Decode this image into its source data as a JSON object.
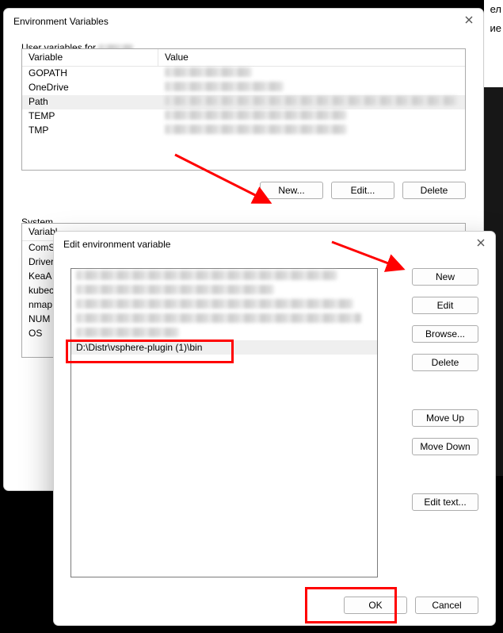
{
  "bg_fragments": {
    "f1": "ел",
    "f2": "ие"
  },
  "win1": {
    "title": "Environment Variables",
    "groups": {
      "user": {
        "label_prefix": "User variables for ",
        "columns": {
          "c1": "Variable",
          "c2": "Value"
        },
        "rows": [
          {
            "name": "GOPATH"
          },
          {
            "name": "OneDrive"
          },
          {
            "name": "Path",
            "selected": true
          },
          {
            "name": "TEMP"
          },
          {
            "name": "TMP"
          }
        ],
        "buttons": {
          "new": "New...",
          "edit": "Edit...",
          "delete": "Delete"
        }
      },
      "system": {
        "label": "System",
        "columns": {
          "c1": "Variabl",
          "c2": ""
        },
        "rows": [
          {
            "name": "ComS"
          },
          {
            "name": "Driver"
          },
          {
            "name": "KeaA"
          },
          {
            "name": "kubec"
          },
          {
            "name": "nmap"
          },
          {
            "name": "NUM"
          },
          {
            "name": "OS"
          }
        ]
      }
    }
  },
  "win2": {
    "title": "Edit environment variable",
    "entries": [
      {
        "visible": false
      },
      {
        "visible": false
      },
      {
        "visible": false
      },
      {
        "visible": false
      },
      {
        "visible": false
      },
      {
        "visible": true,
        "value": "D:\\Distr\\vsphere-plugin (1)\\bin",
        "selected": true
      }
    ],
    "side_buttons": {
      "new": "New",
      "edit": "Edit",
      "browse": "Browse...",
      "delete": "Delete",
      "moveup": "Move Up",
      "movedown": "Move Down",
      "edittext": "Edit text..."
    },
    "footer": {
      "ok": "OK",
      "cancel": "Cancel"
    }
  }
}
